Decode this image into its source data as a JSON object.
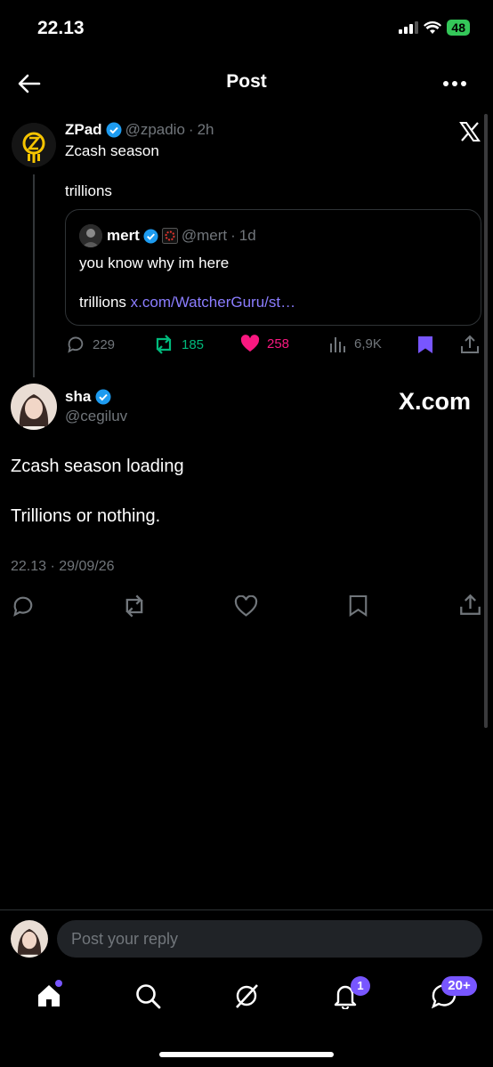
{
  "status_bar": {
    "time": "22.13",
    "battery": "48"
  },
  "header": {
    "title": "Post"
  },
  "parent_post": {
    "author_name": "ZPad",
    "handle": "@zpadio",
    "time": "2h",
    "lines": [
      "Zcash season",
      "trillions"
    ],
    "quote": {
      "author_name": "mert",
      "handle": "@mert",
      "time": "1d",
      "text_1": "you know why im here",
      "text_2": "trillions",
      "link": "x.com/WatcherGuru/st…"
    },
    "stats": {
      "replies": "229",
      "reposts": "185",
      "likes": "258",
      "views": "6,9K"
    }
  },
  "main_post": {
    "author_name": "sha",
    "handle": "@cegiluv",
    "watermark": "X.com",
    "text_1": "Zcash season loading",
    "text_2": "Trillions or nothing.",
    "timestamp": "22.13 · 29/09/26"
  },
  "reply": {
    "placeholder": "Post your reply"
  },
  "tab_bar": {
    "notifications_badge": "1",
    "messages_badge": "20+"
  },
  "colors": {
    "accent": "#7856ff",
    "verified": "#1d9bf0",
    "repost": "#00ba7c",
    "like": "#f91880"
  }
}
